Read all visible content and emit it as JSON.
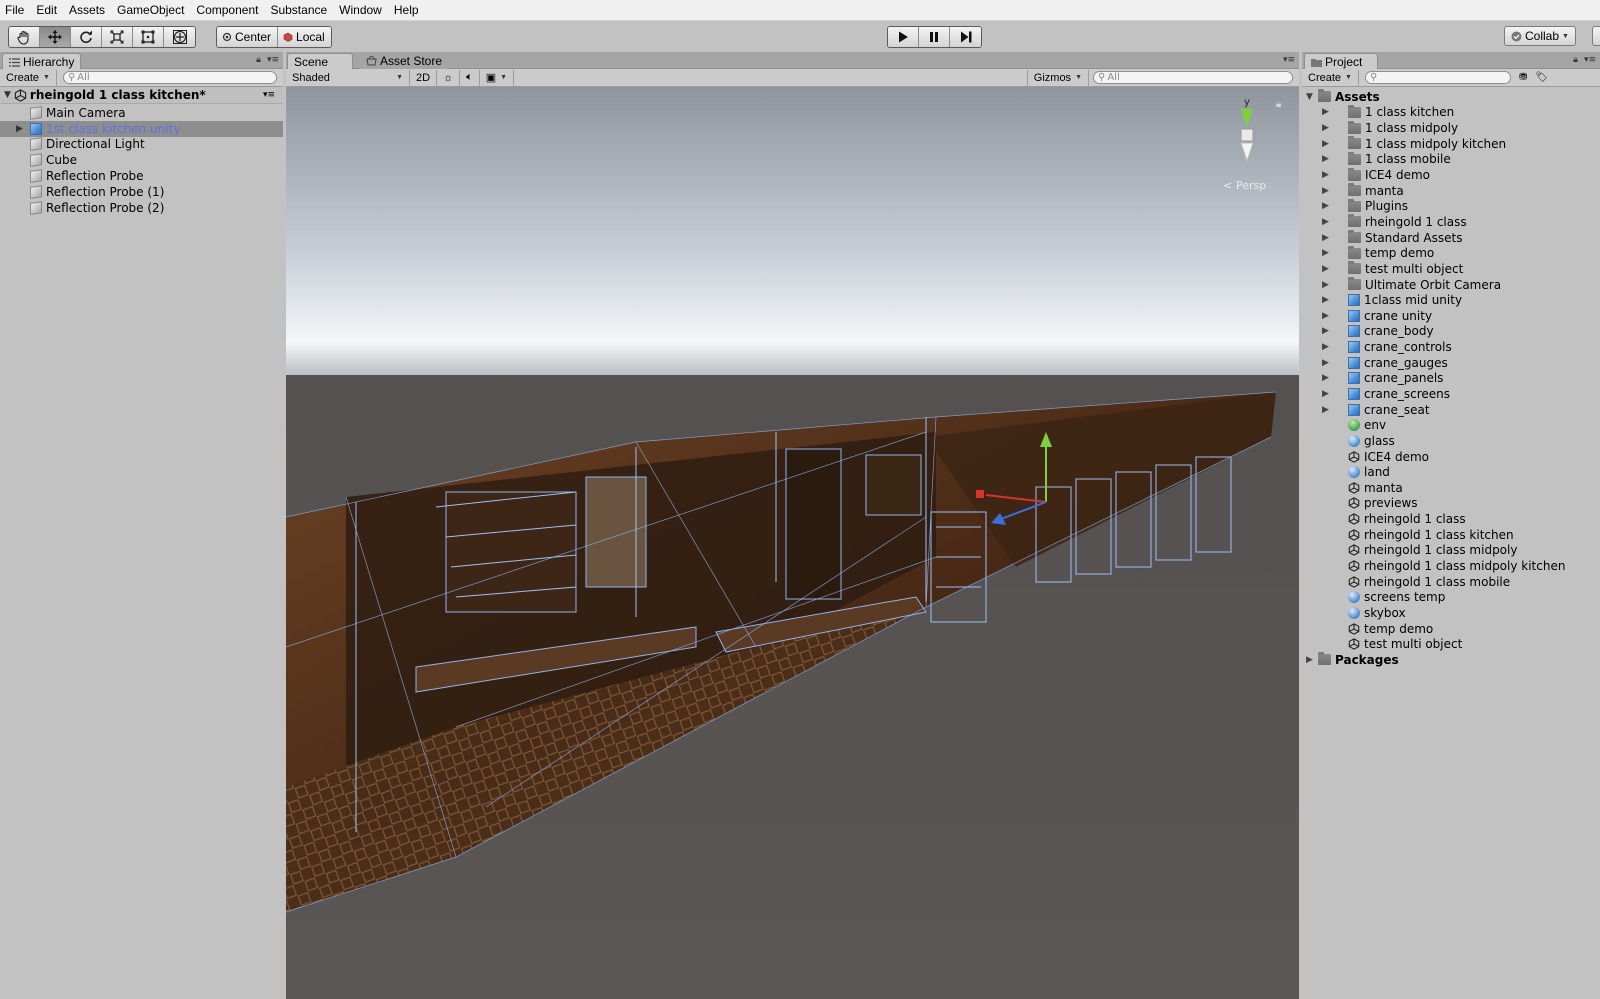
{
  "menu": [
    "File",
    "Edit",
    "Assets",
    "GameObject",
    "Component",
    "Substance",
    "Window",
    "Help"
  ],
  "toolbar": {
    "tools": [
      "hand-tool",
      "move-tool",
      "rotate-tool",
      "scale-tool",
      "rect-tool",
      "transform-tool"
    ],
    "active_tool": "move-tool",
    "pivot_mode": "Center",
    "pivot_rotation": "Local",
    "collab_label": "Collab"
  },
  "hierarchy": {
    "tab_label": "Hierarchy",
    "create_label": "Create",
    "search_placeholder": "All",
    "scene_name": "rheingold 1 class kitchen*",
    "items": [
      {
        "label": "Main Camera",
        "selected": false,
        "expandable": false
      },
      {
        "label": "1st class kitchen unity",
        "selected": true,
        "expandable": true
      },
      {
        "label": "Directional Light",
        "selected": false,
        "expandable": false
      },
      {
        "label": "Cube",
        "selected": false,
        "expandable": false
      },
      {
        "label": "Reflection Probe",
        "selected": false,
        "expandable": false
      },
      {
        "label": "Reflection Probe (1)",
        "selected": false,
        "expandable": false
      },
      {
        "label": "Reflection Probe (2)",
        "selected": false,
        "expandable": false
      }
    ]
  },
  "scene": {
    "tabs": [
      "Scene",
      "Asset Store"
    ],
    "shading_mode": "Shaded",
    "mode_2d_label": "2D",
    "gizmos_label": "Gizmos",
    "search_placeholder": "All",
    "gizmo_axis_label": "y",
    "projection_label": "Persp"
  },
  "project": {
    "tab_label": "Project",
    "create_label": "Create",
    "root_label": "Assets",
    "items": [
      {
        "label": "1 class kitchen",
        "icon": "folder",
        "expandable": true
      },
      {
        "label": "1 class midpoly",
        "icon": "folder",
        "expandable": true
      },
      {
        "label": "1 class midpoly kitchen",
        "icon": "folder",
        "expandable": true
      },
      {
        "label": "1 class mobile",
        "icon": "folder",
        "expandable": true
      },
      {
        "label": "ICE4 demo",
        "icon": "folder",
        "expandable": true
      },
      {
        "label": "manta",
        "icon": "folder",
        "expandable": true
      },
      {
        "label": "Plugins",
        "icon": "folder",
        "expandable": true
      },
      {
        "label": "rheingold 1 class",
        "icon": "folder",
        "expandable": true
      },
      {
        "label": "Standard Assets",
        "icon": "folder",
        "expandable": true
      },
      {
        "label": "temp demo",
        "icon": "folder",
        "expandable": true
      },
      {
        "label": "test multi object",
        "icon": "folder",
        "expandable": true
      },
      {
        "label": "Ultimate Orbit Camera",
        "icon": "folder",
        "expandable": true
      },
      {
        "label": "1class mid unity",
        "icon": "prefab",
        "expandable": true
      },
      {
        "label": "crane unity",
        "icon": "prefab",
        "expandable": true
      },
      {
        "label": "crane_body",
        "icon": "prefab",
        "expandable": true
      },
      {
        "label": "crane_controls",
        "icon": "prefab",
        "expandable": true
      },
      {
        "label": "crane_gauges",
        "icon": "prefab",
        "expandable": true
      },
      {
        "label": "crane_panels",
        "icon": "prefab",
        "expandable": true
      },
      {
        "label": "crane_screens",
        "icon": "prefab",
        "expandable": true
      },
      {
        "label": "crane_seat",
        "icon": "prefab",
        "expandable": true
      },
      {
        "label": "env",
        "icon": "env",
        "expandable": false
      },
      {
        "label": "glass",
        "icon": "material",
        "expandable": false
      },
      {
        "label": "ICE4 demo",
        "icon": "scene",
        "expandable": false
      },
      {
        "label": "land",
        "icon": "material",
        "expandable": false
      },
      {
        "label": "manta",
        "icon": "scene",
        "expandable": false
      },
      {
        "label": "previews",
        "icon": "scene",
        "expandable": false
      },
      {
        "label": "rheingold 1 class",
        "icon": "scene",
        "expandable": false
      },
      {
        "label": "rheingold 1 class kitchen",
        "icon": "scene",
        "expandable": false
      },
      {
        "label": "rheingold 1 class midpoly",
        "icon": "scene",
        "expandable": false
      },
      {
        "label": "rheingold 1 class midpoly kitchen",
        "icon": "scene",
        "expandable": false
      },
      {
        "label": "rheingold 1 class mobile",
        "icon": "scene",
        "expandable": false
      },
      {
        "label": "screens temp",
        "icon": "material",
        "expandable": false
      },
      {
        "label": "skybox",
        "icon": "material",
        "expandable": false
      },
      {
        "label": "temp demo",
        "icon": "scene",
        "expandable": false
      },
      {
        "label": "test multi object",
        "icon": "scene",
        "expandable": false
      }
    ],
    "packages_label": "Packages"
  },
  "colors": {
    "selection_text": "#5b73e6",
    "panel_bg": "#c2c2c2",
    "wireframe": "#7fa7e8"
  }
}
